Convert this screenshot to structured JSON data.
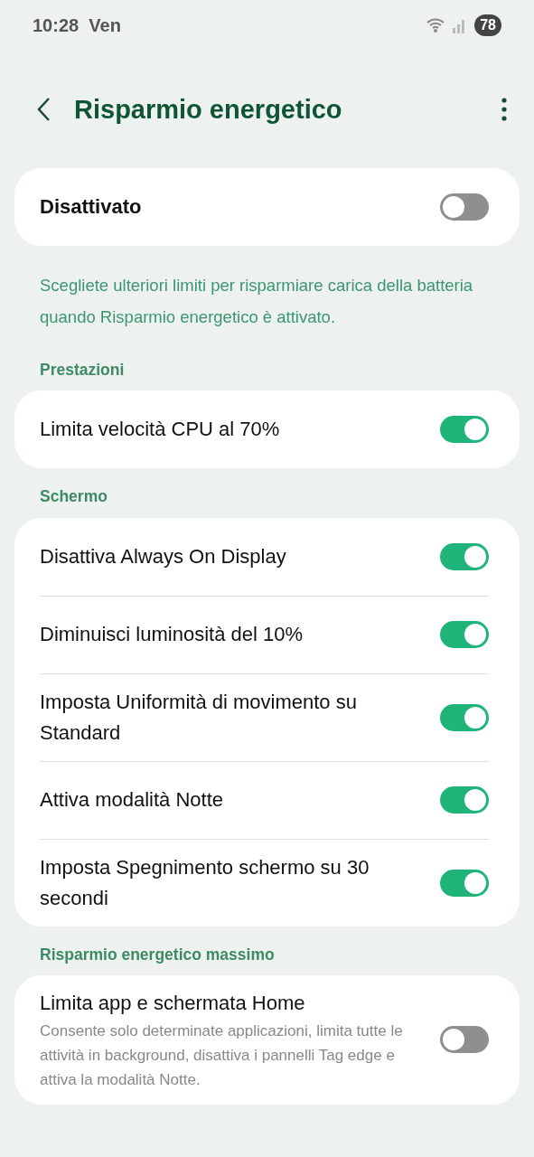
{
  "status_bar": {
    "time": "10:28",
    "day": "Ven",
    "battery": "78"
  },
  "header": {
    "title": "Risparmio energetico"
  },
  "master": {
    "label": "Disattivato",
    "on": false
  },
  "description": "Scegliete ulteriori limiti per risparmiare carica della batteria quando Risparmio energetico è attivato.",
  "sections": [
    {
      "title": "Prestazioni",
      "items": [
        {
          "label": "Limita velocità CPU al 70%",
          "on": true
        }
      ]
    },
    {
      "title": "Schermo",
      "items": [
        {
          "label": "Disattiva Always On Display",
          "on": true
        },
        {
          "label": "Diminuisci luminosità del 10%",
          "on": true
        },
        {
          "label": "Imposta Uniformità di movimento su Standard",
          "on": true
        },
        {
          "label": "Attiva modalità Notte",
          "on": true
        },
        {
          "label": "Imposta Spegnimento schermo su 30 secondi",
          "on": true
        }
      ]
    },
    {
      "title": "Risparmio energetico massimo",
      "items": [
        {
          "label": "Limita app e schermata Home",
          "summary": "Consente solo determinate applicazioni, limita tutte le attività in background, disattiva i pannelli Tag edge e attiva la modalità Notte.",
          "on": false
        }
      ]
    }
  ]
}
